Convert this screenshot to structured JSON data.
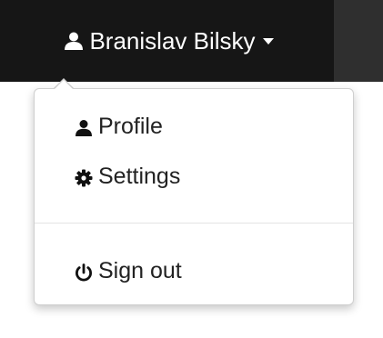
{
  "user_menu": {
    "user_name": "Branislav Bilsky",
    "toggle_icon": "user-icon",
    "caret_icon": "caret-down-icon"
  },
  "dropdown": {
    "items": [
      {
        "label": "Profile",
        "icon": "user-icon"
      },
      {
        "label": "Settings",
        "icon": "gear-icon"
      },
      {
        "label": "Sign out",
        "icon": "power-icon"
      }
    ]
  },
  "colors": {
    "navbar_active": "#161616",
    "navbar": "#2f2f2f",
    "menu_bg": "#ffffff",
    "menu_text": "#222222",
    "divider": "#e3e3e3"
  }
}
